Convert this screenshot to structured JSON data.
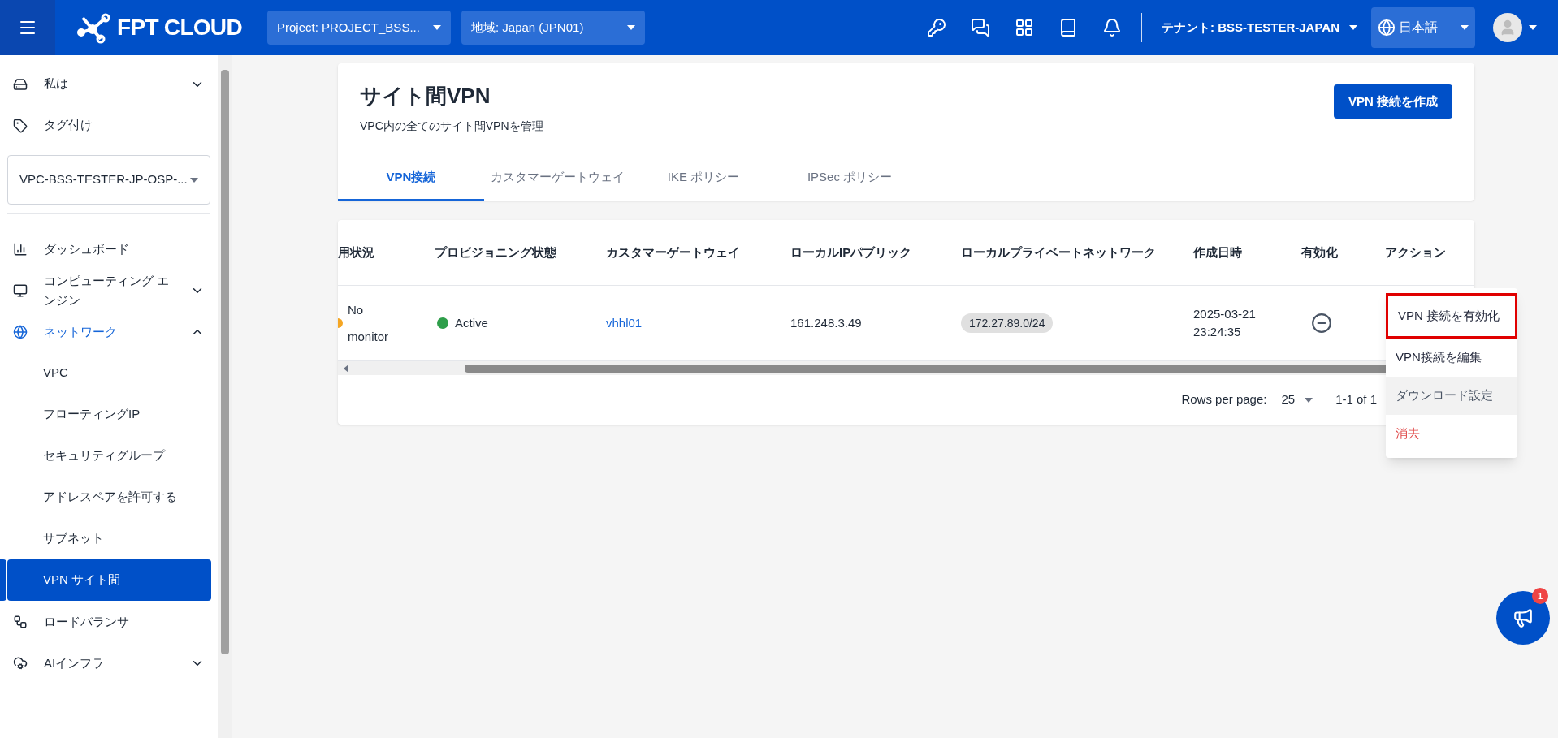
{
  "header": {
    "logo_text": "FPT CLOUD",
    "project_select": {
      "value": "Project: PROJECT_BSS..."
    },
    "region_select": {
      "value": "地域: Japan (JPN01)"
    },
    "tenant": "テナント: BSS-TESTER-JAPAN",
    "language": "日本語"
  },
  "sidebar": {
    "top_items": [
      {
        "label": "私は",
        "expanded": false
      },
      {
        "label": "タグ付け"
      }
    ],
    "vpc_select": {
      "value": "VPC-BSS-TESTER-JP-OSP-..."
    },
    "items": [
      {
        "label": "ダッシュボード"
      },
      {
        "label": "コンピューティング エンジン",
        "expanded": false
      },
      {
        "label": "ネットワーク",
        "expanded": true,
        "children": [
          {
            "label": "VPC",
            "selected": false
          },
          {
            "label": "フローティングIP",
            "selected": false
          },
          {
            "label": "セキュリティグループ",
            "selected": false
          },
          {
            "label": "アドレスペアを許可する",
            "selected": false
          },
          {
            "label": "サブネット",
            "selected": false
          },
          {
            "label": "VPN サイト間",
            "selected": true
          }
        ]
      },
      {
        "label": "ロードバランサ"
      },
      {
        "label": "AIインフラ",
        "expanded": false
      }
    ]
  },
  "page": {
    "title": "サイト間VPN",
    "subtitle": "VPC内の全てのサイト間VPNを管理",
    "create_button": "VPN 接続を作成",
    "tabs": [
      {
        "label": "VPN接続",
        "selected": true
      },
      {
        "label": "カスタマーゲートウェイ",
        "selected": false
      },
      {
        "label": "IKE ポリシー",
        "selected": false
      },
      {
        "label": "IPSec ポリシー",
        "selected": false
      }
    ]
  },
  "table": {
    "columns": [
      "用状況",
      "プロビジョニング状態",
      "カスタマーゲートウェイ",
      "ローカルIPパブリック",
      "ローカルプライベートネットワーク",
      "作成日時",
      "有効化",
      "アクション"
    ],
    "rows": [
      {
        "monitor": {
          "text": "No monitor",
          "color": "#f5a623"
        },
        "provisioning": {
          "text": "Active",
          "color": "#2e9e4a"
        },
        "gateway": "vhhl01",
        "local_ip": "161.248.3.49",
        "private_network": "172.27.89.0/24",
        "created": "2025-03-21 23:24:35",
        "enabled": false
      }
    ]
  },
  "pagination": {
    "rows_per_page_label": "Rows per page:",
    "rows_per_page": "25",
    "range": "1-1 of 1"
  },
  "action_menu": [
    {
      "label": "VPN 接続を有効化",
      "kind": "normal",
      "highlighted": true,
      "hovered": false
    },
    {
      "label": "VPN接続を編集",
      "kind": "normal",
      "highlighted": false,
      "hovered": false
    },
    {
      "label": "ダウンロード設定",
      "kind": "normal",
      "highlighted": false,
      "hovered": true
    },
    {
      "label": "消去",
      "kind": "danger",
      "highlighted": false,
      "hovered": false
    }
  ],
  "fab": {
    "badge": "1"
  }
}
